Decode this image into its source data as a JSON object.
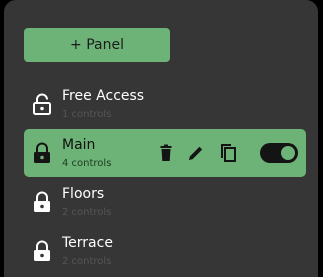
{
  "colors": {
    "page_background": "#000000",
    "panel_background": "#363636",
    "accent_green": "#6db377",
    "toggle_track": "#141414",
    "subtitle_gray": "#565656"
  },
  "add_panel_button": {
    "label": "+ Panel"
  },
  "panels": [
    {
      "name": "Free Access",
      "subtitle": "1 controls",
      "lock_icon": "lock-open-icon",
      "selected": false
    },
    {
      "name": "Main",
      "subtitle": "4 controls",
      "lock_icon": "lock-icon",
      "selected": true
    },
    {
      "name": "Floors",
      "subtitle": "2 controls",
      "lock_icon": "lock-icon",
      "selected": false
    },
    {
      "name": "Terrace",
      "subtitle": "2 controls",
      "lock_icon": "lock-icon",
      "selected": false
    }
  ],
  "selected_actions": {
    "icons": [
      "trash-icon",
      "pencil-icon",
      "copy-icon"
    ],
    "toggle_on": true
  }
}
